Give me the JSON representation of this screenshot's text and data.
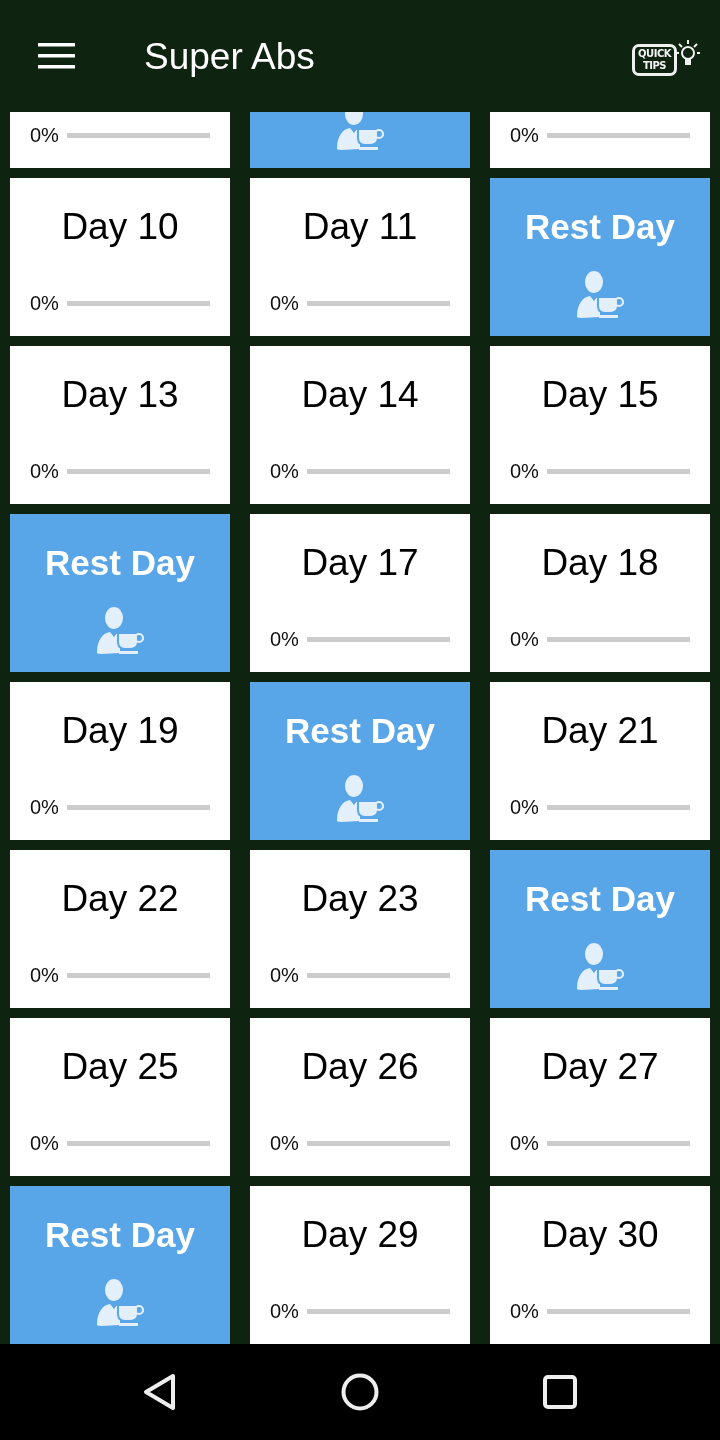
{
  "app_bar": {
    "title": "Super Abs",
    "tips_button": {
      "line_1": "QUICK",
      "line_2": "TIPS"
    }
  },
  "days": [
    {
      "kind": "workout",
      "progress": "0%",
      "level": 0
    },
    {
      "kind": "rest"
    },
    {
      "kind": "workout",
      "progress": "0%",
      "level": 0
    },
    {
      "kind": "workout",
      "title": "Day 10",
      "progress": "0%",
      "level": 0
    },
    {
      "kind": "workout",
      "title": "Day 11",
      "progress": "0%",
      "level": 0
    },
    {
      "kind": "rest",
      "title": "Rest Day"
    },
    {
      "kind": "workout",
      "title": "Day 13",
      "progress": "0%",
      "level": 0
    },
    {
      "kind": "workout",
      "title": "Day 14",
      "progress": "0%",
      "level": 0
    },
    {
      "kind": "workout",
      "title": "Day 15",
      "progress": "0%",
      "level": 0
    },
    {
      "kind": "rest",
      "title": "Rest Day"
    },
    {
      "kind": "workout",
      "title": "Day 17",
      "progress": "0%",
      "level": 0
    },
    {
      "kind": "workout",
      "title": "Day 18",
      "progress": "0%",
      "level": 0
    },
    {
      "kind": "workout",
      "title": "Day 19",
      "progress": "0%",
      "level": 0
    },
    {
      "kind": "rest",
      "title": "Rest Day"
    },
    {
      "kind": "workout",
      "title": "Day 21",
      "progress": "0%",
      "level": 0
    },
    {
      "kind": "workout",
      "title": "Day 22",
      "progress": "0%",
      "level": 0
    },
    {
      "kind": "workout",
      "title": "Day 23",
      "progress": "0%",
      "level": 0
    },
    {
      "kind": "rest",
      "title": "Rest Day"
    },
    {
      "kind": "workout",
      "title": "Day 25",
      "progress": "0%",
      "level": 0
    },
    {
      "kind": "workout",
      "title": "Day 26",
      "progress": "0%",
      "level": 0
    },
    {
      "kind": "workout",
      "title": "Day 27",
      "progress": "0%",
      "level": 0
    },
    {
      "kind": "rest",
      "title": "Rest Day"
    },
    {
      "kind": "workout",
      "title": "Day 29",
      "progress": "0%",
      "level": 0
    },
    {
      "kind": "workout",
      "title": "Day 30",
      "progress": "0%",
      "level": 0
    }
  ]
}
